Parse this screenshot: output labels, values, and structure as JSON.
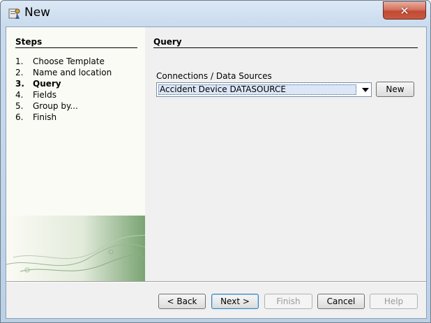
{
  "window": {
    "title": "New",
    "close_label": "✕",
    "accent_color": "#c04a33",
    "app_icon": "wizard-app-icon"
  },
  "steps": {
    "title": "Steps",
    "items": [
      {
        "num": "1.",
        "label": "Choose Template",
        "active": false
      },
      {
        "num": "2.",
        "label": "Name and location",
        "active": false
      },
      {
        "num": "3.",
        "label": "Query",
        "active": true
      },
      {
        "num": "4.",
        "label": "Fields",
        "active": false
      },
      {
        "num": "5.",
        "label": "Group by...",
        "active": false
      },
      {
        "num": "6.",
        "label": "Finish",
        "active": false
      }
    ]
  },
  "main": {
    "title": "Query",
    "connections_label": "Connections / Data Sources",
    "connection_selected": "Accident Device DATASOURCE",
    "new_button": "New"
  },
  "footer": {
    "back": "< Back",
    "next": "Next >",
    "finish": "Finish",
    "cancel": "Cancel",
    "help": "Help"
  }
}
